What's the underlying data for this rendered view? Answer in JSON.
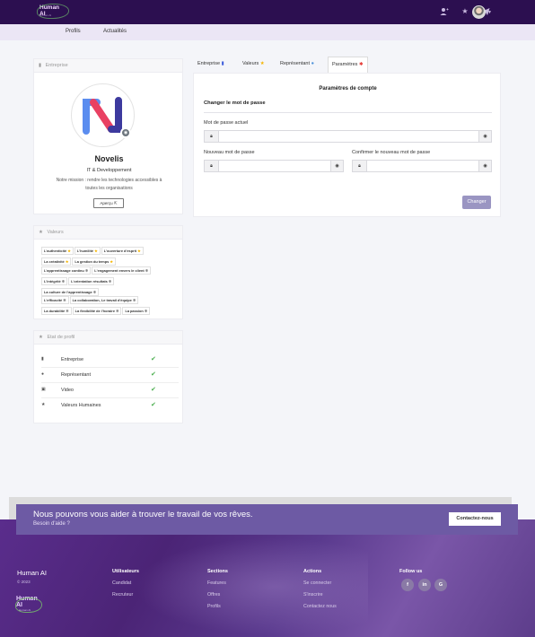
{
  "brand": {
    "name": "Human AI",
    "tagline": "Human AI"
  },
  "topbar": {
    "icons": [
      "user-plus-icon",
      "star-icon",
      "send-icon"
    ],
    "avatar": "user-avatar"
  },
  "subnav": {
    "items": [
      "Profils",
      "Actualités"
    ]
  },
  "company_card": {
    "header": "Entreprise",
    "name": "Novelis",
    "sector": "IT & Developpement",
    "mission_line1": "Notre mission : rendre les technologies accessibles à",
    "mission_line2": "toutes les organisations",
    "preview_label": "Aperçu"
  },
  "values_card": {
    "header": "Valeurs",
    "groups": [
      [
        {
          "label": "L'authenticité",
          "mark": "★"
        },
        {
          "label": "L'humilité",
          "mark": "★"
        },
        {
          "label": "L'ouverture d'esprit",
          "mark": "★"
        },
        {
          "label": "La créativité",
          "mark": "★"
        },
        {
          "label": "La gestion du temps",
          "mark": "★"
        }
      ],
      [
        {
          "label": "L'apprentissage continu",
          "mark": "✱"
        },
        {
          "label": "L'engagement envers le client",
          "mark": "✱"
        },
        {
          "label": "L'intégrité",
          "mark": "✱"
        },
        {
          "label": "L'orientation résultats",
          "mark": "✱"
        },
        {
          "label": "La culture de l'apprentissage",
          "mark": "✱"
        }
      ],
      [
        {
          "label": "L'efficacité",
          "mark": "✱"
        },
        {
          "label": "La collaboration, Le travail d'équipe",
          "mark": "✱"
        },
        {
          "label": "La durabilité",
          "mark": "✱"
        },
        {
          "label": "La flexibilité de l'horaire",
          "mark": "✱"
        },
        {
          "label": "La passion",
          "mark": "✱"
        }
      ]
    ]
  },
  "status_card": {
    "header": "Etat de profil",
    "rows": [
      {
        "label": "Entreprise",
        "icon": "building-icon"
      },
      {
        "label": "Représentant",
        "icon": "person-icon"
      },
      {
        "label": "Video",
        "icon": "video-icon"
      },
      {
        "label": "Valeurs Humaines",
        "icon": "star-icon"
      }
    ]
  },
  "tabs": [
    {
      "label": "Entreprise",
      "icon": "bookmark-icon",
      "color": "#3b5bdb"
    },
    {
      "label": "Valeurs",
      "icon": "star-icon",
      "color": "#f4b400"
    },
    {
      "label": "Représentant",
      "icon": "person-icon",
      "color": "#4a90d9"
    },
    {
      "label": "Paramètres",
      "icon": "gear-icon",
      "color": "#e53935"
    }
  ],
  "settings": {
    "title": "Paramètres de compte",
    "section": "Changer le mot de passe",
    "current_label": "Mot de passe actuel",
    "new_label": "Nouveau mot de passe",
    "confirm_label": "Confirmer le nouveau mot de passe",
    "submit": "Changer"
  },
  "cta": {
    "title": "Nous pouvons vous aider à trouver le travail de vos rêves.",
    "subtitle": "Besoin d'aide ?",
    "button": "Contactez-nous"
  },
  "footer": {
    "brand": "Human AI",
    "copyright": "© 2023",
    "columns": [
      {
        "title": "Utilisateurs",
        "items": [
          "Candidat",
          "Recruteur"
        ]
      },
      {
        "title": "Sections",
        "items": [
          "Features",
          "Offres",
          "Profils"
        ]
      },
      {
        "title": "Actions",
        "items": [
          "Se connecter",
          "S'inscrire",
          "Contactez nous"
        ]
      },
      {
        "title": "Follow us",
        "items": []
      }
    ],
    "social": [
      {
        "name": "facebook-icon",
        "glyph": "f"
      },
      {
        "name": "linkedin-icon",
        "glyph": "in"
      },
      {
        "name": "google-icon",
        "glyph": "G"
      }
    ]
  }
}
